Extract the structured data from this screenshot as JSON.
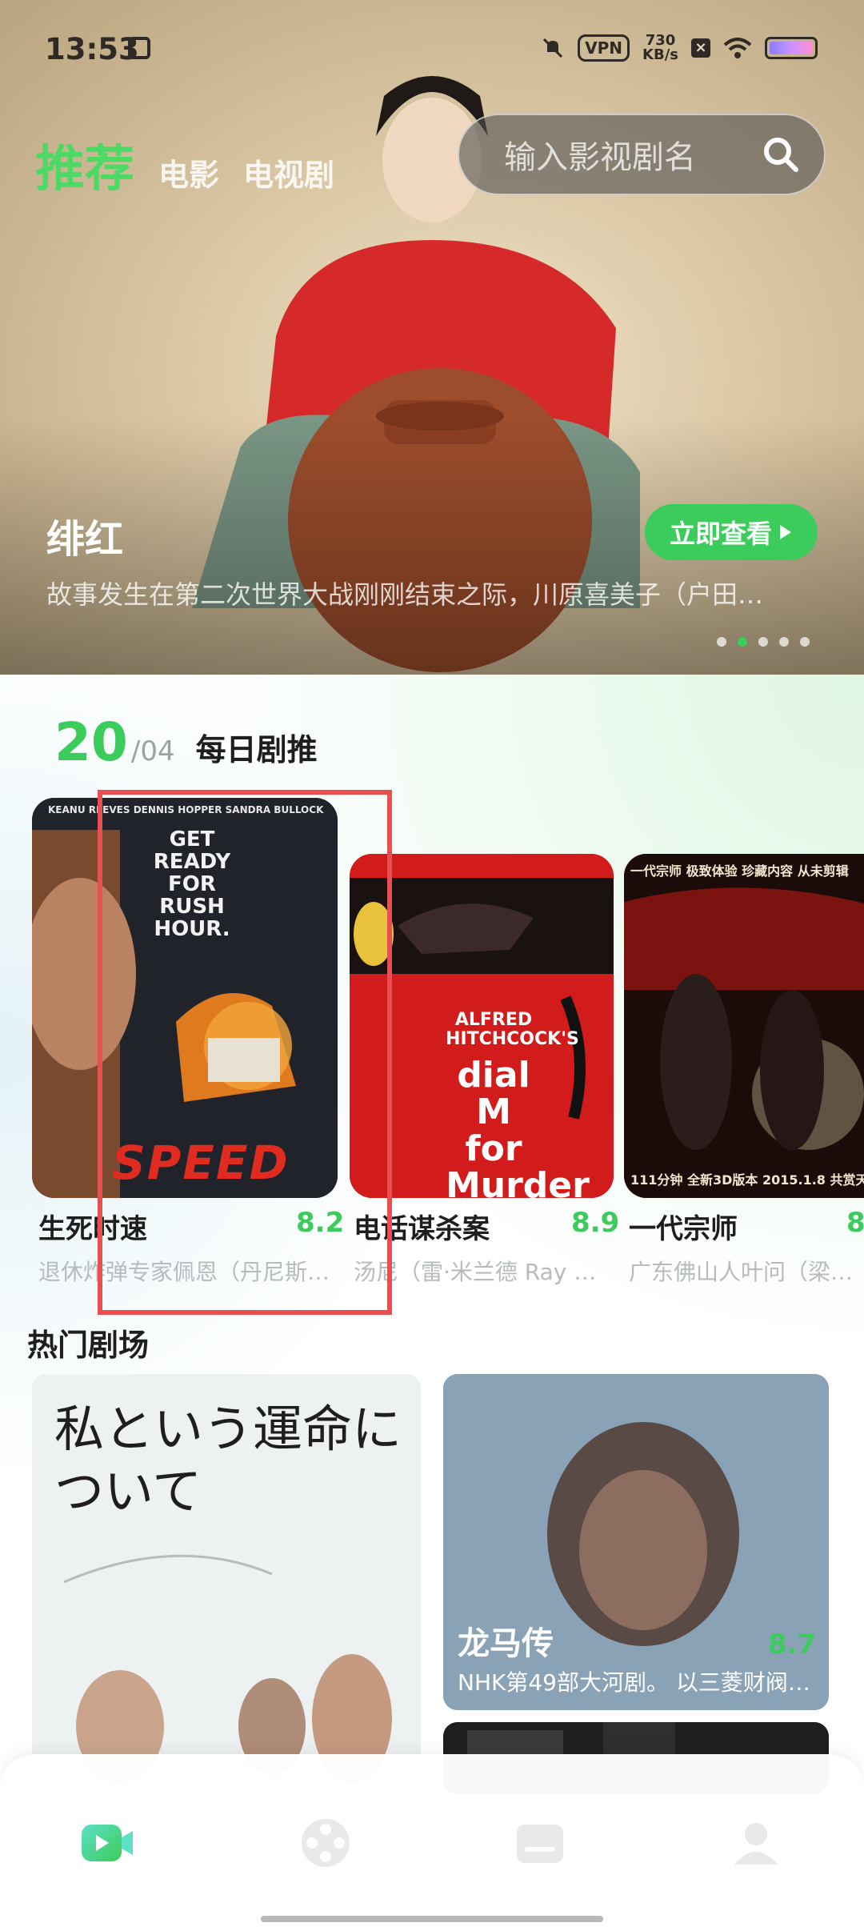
{
  "status_bar": {
    "time": "13:53",
    "vpn": "VPN",
    "speed_value": "730",
    "speed_unit": "KB/s"
  },
  "top_tabs": [
    {
      "label": "推荐",
      "active": true
    },
    {
      "label": "电影",
      "active": false
    },
    {
      "label": "电视剧",
      "active": false
    }
  ],
  "search": {
    "placeholder": "输入影视剧名",
    "icon": "search-icon"
  },
  "hero": {
    "title": "绯红",
    "cta": "立即查看",
    "description": "故事发生在第二次世界大战刚刚结束之际，川原喜美子（户田…",
    "slide_count": 5,
    "active_slide": 2
  },
  "daily": {
    "day": "20",
    "month": "/04",
    "title": "每日剧推",
    "items": [
      {
        "title": "生死时速",
        "score": "8.2",
        "description": "退休炸弹专家佩恩（丹尼斯·…",
        "poster_top_text": "KEANU REEVES  DENNIS HOPPER  SANDRA BULLOCK",
        "poster_tagline": "GET READY FOR RUSH HOUR.",
        "poster_logo": "SPEED"
      },
      {
        "title": "电话谋杀案",
        "score": "8.9",
        "description": "汤尼（雷·米兰德 Ray Mi…",
        "poster_credit": "ALFRED HITCHCOCK'S",
        "poster_title": "dial M for Murder"
      },
      {
        "title": "一代宗师",
        "score": "8",
        "description": "广东佛山人叶问（梁朝…",
        "poster_header": "一代宗师  极致体验  珍藏内容  从未剪辑",
        "poster_footer": "111分钟  全新3D版本  2015.1.8  共赏天"
      }
    ]
  },
  "hot": {
    "title": "热门剧场",
    "cards": [
      {
        "poster_text": "私という運命について"
      },
      {
        "title": "龙马传",
        "score": "8.7",
        "description": "NHK第49部大河剧。 以三菱财阀…"
      }
    ]
  },
  "bottom_nav": [
    {
      "name": "video-icon",
      "active": true
    },
    {
      "name": "film-reel-icon",
      "active": false
    },
    {
      "name": "folder-icon",
      "active": false
    },
    {
      "name": "profile-icon",
      "active": false
    }
  ],
  "colors": {
    "accent": "#3ccc5b",
    "highlight": "#e84f50"
  }
}
